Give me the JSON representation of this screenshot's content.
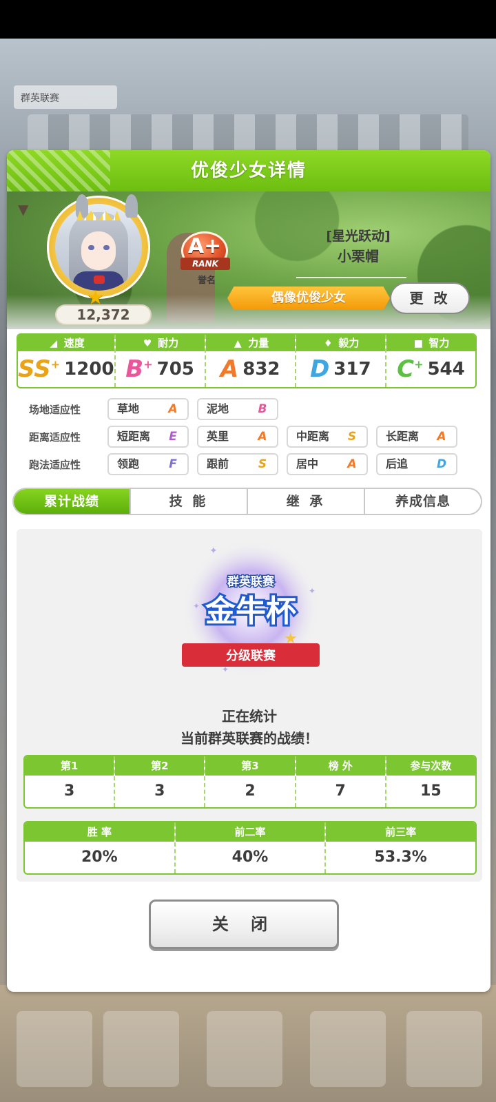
{
  "background": {
    "chip_text": "群英联赛"
  },
  "dialog": {
    "title": "优俊少女详情"
  },
  "character": {
    "fans": "12,372",
    "rank_letter": "A+",
    "rank_ribbon": "RANK",
    "rank_label": "誉名",
    "epithet": "[星光跃动]",
    "name": "小栗帽",
    "title_banner": "偶像优俊少女",
    "change_label": "更 改"
  },
  "stats": [
    {
      "label": "速度",
      "icon": "shoe-icon",
      "grade": "SS",
      "grade_plus": "+",
      "value": "1200",
      "color": "#e8a317"
    },
    {
      "label": "耐力",
      "icon": "heart-icon",
      "grade": "B",
      "grade_plus": "+",
      "value": "705",
      "color": "#e9579a"
    },
    {
      "label": "力量",
      "icon": "muscle-icon",
      "grade": "A",
      "grade_plus": "",
      "value": "832",
      "color": "#f07a2a"
    },
    {
      "label": "毅力",
      "icon": "flame-icon",
      "grade": "D",
      "grade_plus": "",
      "value": "317",
      "color": "#3fa6e0"
    },
    {
      "label": "智力",
      "icon": "graduation-cap-icon",
      "grade": "C",
      "grade_plus": "+",
      "value": "544",
      "color": "#5cc044"
    }
  ],
  "aptitudes": [
    {
      "label": "场地适应性",
      "items": [
        {
          "name": "草地",
          "grade": "A",
          "color": "#f07a2a"
        },
        {
          "name": "泥地",
          "grade": "B",
          "color": "#e9579a"
        }
      ]
    },
    {
      "label": "距离适应性",
      "items": [
        {
          "name": "短距离",
          "grade": "E",
          "color": "#b05ad0"
        },
        {
          "name": "英里",
          "grade": "A",
          "color": "#f07a2a"
        },
        {
          "name": "中距离",
          "grade": "S",
          "color": "#e8a317"
        },
        {
          "name": "长距离",
          "grade": "A",
          "color": "#f07a2a"
        }
      ]
    },
    {
      "label": "跑法适应性",
      "items": [
        {
          "name": "领跑",
          "grade": "F",
          "color": "#7e6fd0"
        },
        {
          "name": "跟前",
          "grade": "S",
          "color": "#e8a317"
        },
        {
          "name": "居中",
          "grade": "A",
          "color": "#f07a2a"
        },
        {
          "name": "后追",
          "grade": "D",
          "color": "#3fa6e0"
        }
      ]
    }
  ],
  "tabs": [
    {
      "label": "累计战绩",
      "active": true
    },
    {
      "label": "技 能",
      "active": false
    },
    {
      "label": "继 承",
      "active": false
    },
    {
      "label": "养成信息",
      "active": false
    }
  ],
  "league_logo": {
    "top": "群英联赛",
    "main": "金牛杯",
    "ribbon": "分级联赛"
  },
  "message": {
    "line1": "正在统计",
    "line2": "当前群英联赛的战绩！"
  },
  "results": {
    "headers": [
      "第1",
      "第2",
      "第3",
      "榜 外",
      "参与次数"
    ],
    "values": [
      "3",
      "3",
      "2",
      "7",
      "15"
    ]
  },
  "rates": {
    "headers": [
      "胜 率",
      "前二率",
      "前三率"
    ],
    "values": [
      "20%",
      "40%",
      "53.3%"
    ]
  },
  "close_label": "关 闭"
}
